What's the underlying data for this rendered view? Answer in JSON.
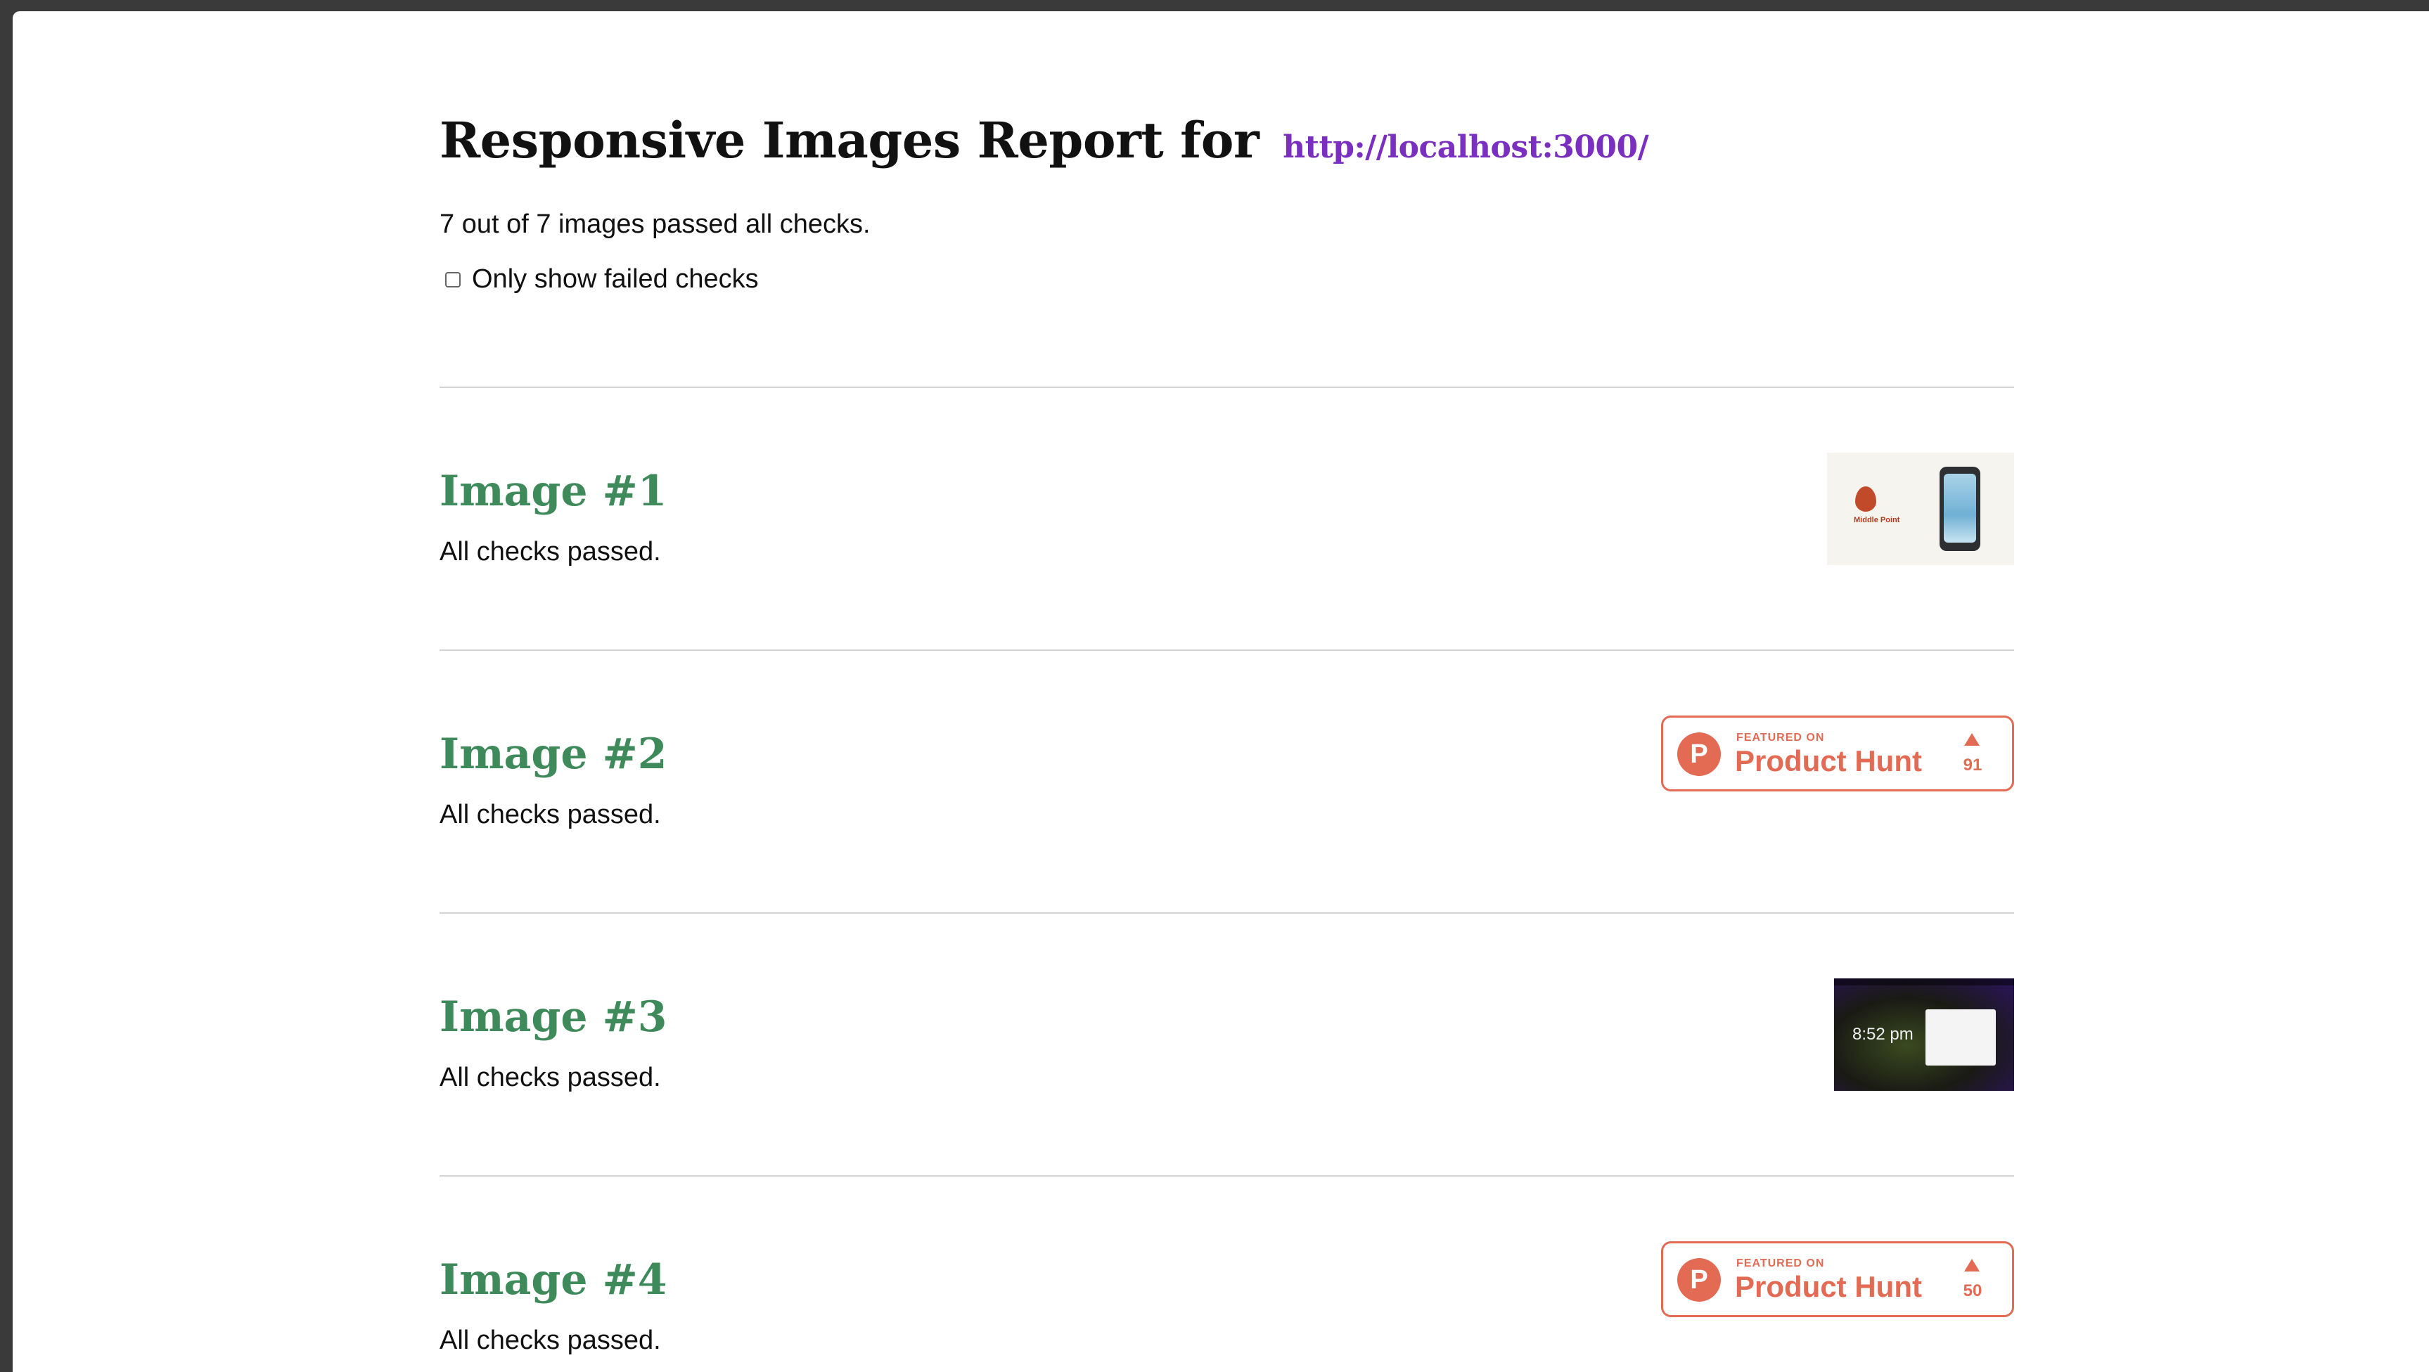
{
  "report": {
    "title_prefix": "Responsive Images Report for",
    "url": "http://localhost:3000/",
    "summary": "7 out of 7 images passed all checks.",
    "filter_label": "Only show failed checks",
    "filter_checked": false
  },
  "images": [
    {
      "title": "Image #1",
      "status": "All checks passed.",
      "thumbnail": {
        "kind": "app-promo",
        "logo_text": "Middle Point"
      }
    },
    {
      "title": "Image #2",
      "status": "All checks passed.",
      "thumbnail": {
        "kind": "product-hunt-badge",
        "featured": "FEATURED ON",
        "name": "Product Hunt",
        "logo_letter": "P",
        "count": "91"
      }
    },
    {
      "title": "Image #3",
      "status": "All checks passed.",
      "thumbnail": {
        "kind": "desktop-screenshot",
        "time": "8:52 pm"
      }
    },
    {
      "title": "Image #4",
      "status": "All checks passed.",
      "thumbnail": {
        "kind": "product-hunt-badge",
        "featured": "FEATURED ON",
        "name": "Product Hunt",
        "logo_letter": "P",
        "count": "50"
      }
    }
  ],
  "colors": {
    "title_green": "#3e8a5a",
    "link_purple": "#7a2fc0",
    "product_hunt": "#e36b54"
  }
}
